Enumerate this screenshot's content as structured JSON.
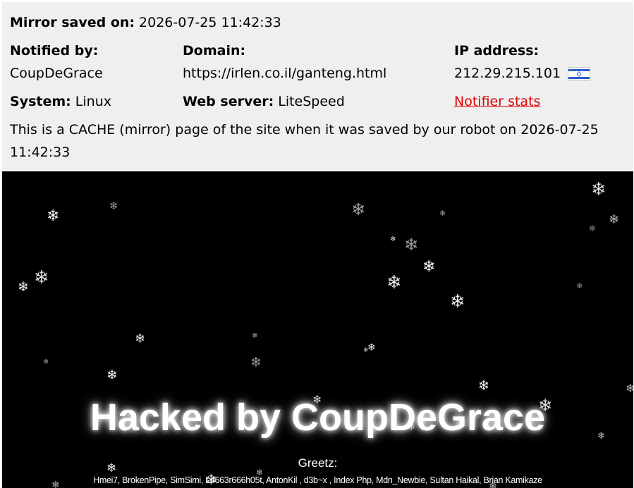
{
  "header": {
    "mirror_saved_label": "Mirror saved on:",
    "mirror_saved_value": "2026-07-25 11:42:33",
    "notified_by_label": "Notified by:",
    "notified_by_value": "CoupDeGrace",
    "domain_label": "Domain:",
    "domain_value": "https://irlen.co.il/ganteng.html",
    "ip_label": "IP address:",
    "ip_value": "212.29.215.101",
    "ip_flag_icon": "israel-flag-icon",
    "system_label": "System:",
    "system_value": "Linux",
    "webserver_label": "Web server:",
    "webserver_value": "LiteSpeed",
    "notifier_stats_link": "Notifier stats",
    "cache_notice_line1": "This is a CACHE (mirror) page of the site when it was saved by our robot on 2026-07-25",
    "cache_notice_line2": "11:42:33"
  },
  "mirror": {
    "headline": "Hacked by CoupDeGrace",
    "greetz_title": "Greetz:",
    "greetz_list": "Hmei7, BrokenPipe, SimSimi, L4663r666h05t, AntonKil , d3b~x , Index Php, Mdn_Newbie, Sultan Haikal, Brian Kamikaze",
    "snowflake_icon": "snowflake-icon"
  },
  "colors": {
    "header_bg": "#efefef",
    "link": "#e00000",
    "mirror_bg": "#000000",
    "text_light": "#ffffff"
  }
}
